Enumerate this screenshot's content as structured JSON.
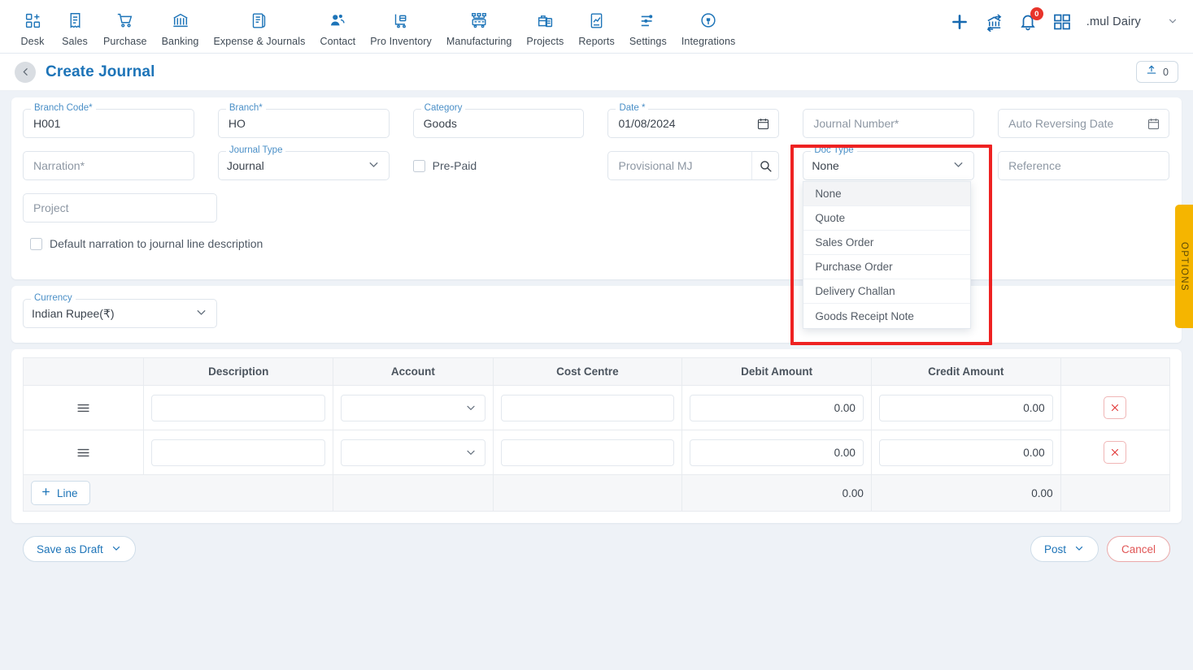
{
  "topnav": {
    "items": [
      {
        "label": "Desk",
        "icon": "dashboard-icon"
      },
      {
        "label": "Sales",
        "icon": "receipt-icon"
      },
      {
        "label": "Purchase",
        "icon": "cart-icon"
      },
      {
        "label": "Banking",
        "icon": "bank-icon"
      },
      {
        "label": "Expense & Journals",
        "icon": "journal-book-icon"
      },
      {
        "label": "Contact",
        "icon": "people-icon"
      },
      {
        "label": "Pro Inventory",
        "icon": "inventory-cart-icon"
      },
      {
        "label": "Manufacturing",
        "icon": "factory-icon"
      },
      {
        "label": "Projects",
        "icon": "briefcase-icon"
      },
      {
        "label": "Reports",
        "icon": "report-chart-icon"
      },
      {
        "label": "Settings",
        "icon": "sliders-icon"
      },
      {
        "label": "Integrations",
        "icon": "plug-icon"
      }
    ],
    "right": {
      "add_icon": "plus-icon",
      "transfer_icon": "bank-transfer-icon",
      "bell_icon": "bell-icon",
      "notification_count": "0",
      "apps_icon": "grid-apps-icon",
      "org_name": ".mul Dairy",
      "caret_icon": "chevron-down-icon"
    }
  },
  "header": {
    "back_icon": "chevron-left-icon",
    "title": "Create Journal",
    "upload_icon": "upload-icon",
    "upload_count": "0"
  },
  "options_tab": {
    "label": "OPTIONS"
  },
  "form": {
    "branch_code": {
      "label": "Branch Code",
      "required": "*",
      "value": "H001"
    },
    "branch": {
      "label": "Branch",
      "required": "*",
      "value": "HO"
    },
    "category": {
      "label": "Category",
      "value": "Goods"
    },
    "date": {
      "label": "Date *",
      "value": "01/08/2024",
      "icon": "calendar-icon"
    },
    "journal_number": {
      "label": "Journal Number",
      "required": "*",
      "placeholder": "Journal Number*",
      "value": ""
    },
    "auto_reversing_date": {
      "label": "Auto Reversing Date",
      "placeholder": "Auto Reversing Date",
      "value": "",
      "icon": "calendar-icon"
    },
    "narration": {
      "label": "Narration",
      "required": "*",
      "placeholder": "Narration*",
      "value": ""
    },
    "journal_type": {
      "label": "Journal Type",
      "value": "Journal",
      "icon": "chevron-down-icon"
    },
    "pre_paid": {
      "label": "Pre-Paid",
      "checked": false
    },
    "provisional_mj": {
      "placeholder": "Provisional MJ",
      "value": "",
      "icon": "search-icon"
    },
    "doc_type": {
      "label": "Doc Type",
      "value": "None",
      "icon": "chevron-down-icon",
      "options": [
        "None",
        "Quote",
        "Sales Order",
        "Purchase Order",
        "Delivery Challan",
        "Goods Receipt Note"
      ],
      "selected_index": 0
    },
    "reference": {
      "label": "Reference",
      "placeholder": "Reference",
      "value": ""
    },
    "project": {
      "label": "Project",
      "placeholder": "Project",
      "value": ""
    },
    "default_narration": {
      "label": "Default narration to journal line description",
      "checked": false
    },
    "currency": {
      "label": "Currency",
      "value": "Indian Rupee(₹)",
      "icon": "chevron-down-icon"
    }
  },
  "table": {
    "columns": [
      "",
      "Description",
      "Account",
      "Cost Centre",
      "Debit Amount",
      "Credit Amount",
      ""
    ],
    "rows": [
      {
        "handle": "drag-handle-icon",
        "description": "",
        "account": "",
        "cost_centre": "",
        "debit": "0.00",
        "credit": "0.00",
        "delete_icon": "close-icon"
      },
      {
        "handle": "drag-handle-icon",
        "description": "",
        "account": "",
        "cost_centre": "",
        "debit": "0.00",
        "credit": "0.00",
        "delete_icon": "close-icon"
      }
    ],
    "totals": {
      "debit": "0.00",
      "credit": "0.00"
    },
    "add_line": {
      "label": "Line",
      "icon": "plus-icon"
    }
  },
  "footer": {
    "save_as_draft": "Save as Draft",
    "post": "Post",
    "cancel": "Cancel"
  },
  "colors": {
    "accent": "#1d74b8",
    "highlight": "#ee2222",
    "options_tab": "#f5b500",
    "danger": "#e23a3a",
    "badge": "#e8332a"
  }
}
